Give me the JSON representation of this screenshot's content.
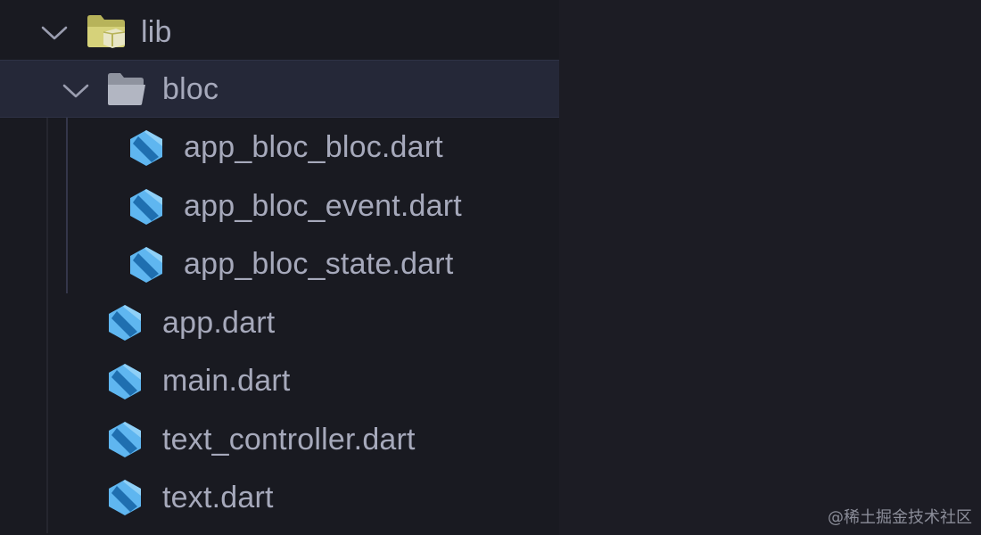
{
  "explorer": {
    "root": {
      "label": "lib",
      "icon": "folder-lib-icon",
      "expanded": true
    },
    "folder": {
      "label": "bloc",
      "icon": "folder-open-icon",
      "expanded": true,
      "selected": true
    },
    "folder_children": [
      {
        "label": "app_bloc_bloc.dart",
        "icon": "dart-file-icon"
      },
      {
        "label": "app_bloc_event.dart",
        "icon": "dart-file-icon"
      },
      {
        "label": "app_bloc_state.dart",
        "icon": "dart-file-icon"
      }
    ],
    "root_files": [
      {
        "label": "app.dart",
        "icon": "dart-file-icon"
      },
      {
        "label": "main.dart",
        "icon": "dart-file-icon"
      },
      {
        "label": "text_controller.dart",
        "icon": "dart-file-icon"
      },
      {
        "label": "text.dart",
        "icon": "dart-file-icon"
      }
    ]
  },
  "watermark": "@稀土掘金技术社区",
  "colors": {
    "panel_bg": "#191a21",
    "selected_bg": "#252838",
    "text": "#a6a9bb",
    "dart_light": "#5fb6f0",
    "dart_dark": "#1f6fb0",
    "folder_yellow": "#c7c46a"
  }
}
